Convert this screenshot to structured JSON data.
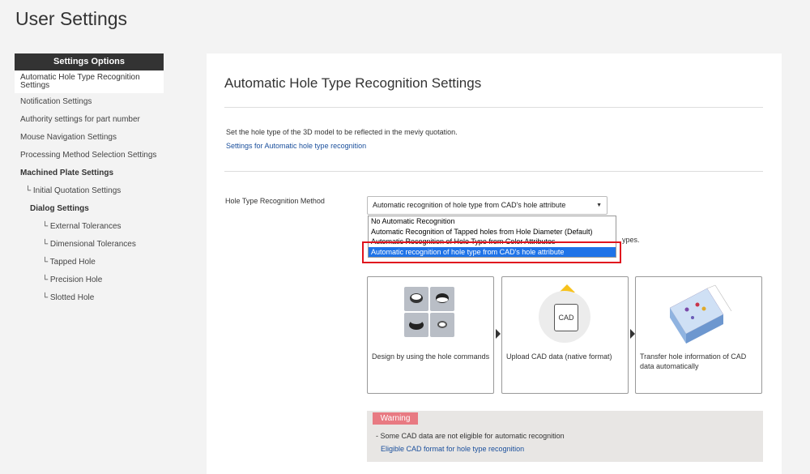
{
  "page": {
    "title": "User Settings"
  },
  "sidebar": {
    "header": "Settings Options",
    "items": [
      {
        "label": "Automatic Hole Type Recognition Settings"
      },
      {
        "label": "Notification Settings"
      },
      {
        "label": "Authority settings for part number"
      },
      {
        "label": "Mouse Navigation Settings"
      },
      {
        "label": "Processing Method Selection Settings"
      },
      {
        "label": "Machined Plate Settings"
      },
      {
        "label": "└ Initial Quotation Settings"
      },
      {
        "label": "Dialog Settings"
      },
      {
        "label": "└ External Tolerances"
      },
      {
        "label": "└ Dimensional Tolerances"
      },
      {
        "label": "└ Tapped Hole"
      },
      {
        "label": "└ Precision Hole"
      },
      {
        "label": "└ Slotted Hole"
      }
    ]
  },
  "main": {
    "title": "Automatic Hole Type Recognition Settings",
    "description": "Set the hole type of the 3D model to be reflected in the meviy quotation.",
    "settings_link": "Settings for Automatic hole type recognition",
    "method_label": "Hole Type Recognition Method",
    "method_value": "Automatic recognition of hole type from CAD's hole attribute",
    "dropdown_options": [
      "No Automatic Recognition",
      "Automatic Recognition of Tapped holes from Hole Diameter (Default)",
      "Automatic Recognition of Hole Type from Color Attributes",
      "Automatic recognition of hole type from CAD's hole attribute"
    ],
    "trailing_text": "ypes.",
    "steps": [
      {
        "text": "Design by using the hole commands"
      },
      {
        "text": "Upload CAD data (native format)",
        "icon_text": "CAD"
      },
      {
        "text": "Transfer hole information of CAD data automatically"
      }
    ],
    "warning": {
      "badge": "Warning",
      "text": "- Some CAD data are not eligible for automatic recognition",
      "link": "Eligible CAD format for hole type recognition"
    }
  },
  "colors": {
    "accent_link": "#1a4f9c",
    "highlight_red": "#e0141e",
    "selected_blue": "#1e73e8",
    "warning_pink": "#e87a82"
  }
}
